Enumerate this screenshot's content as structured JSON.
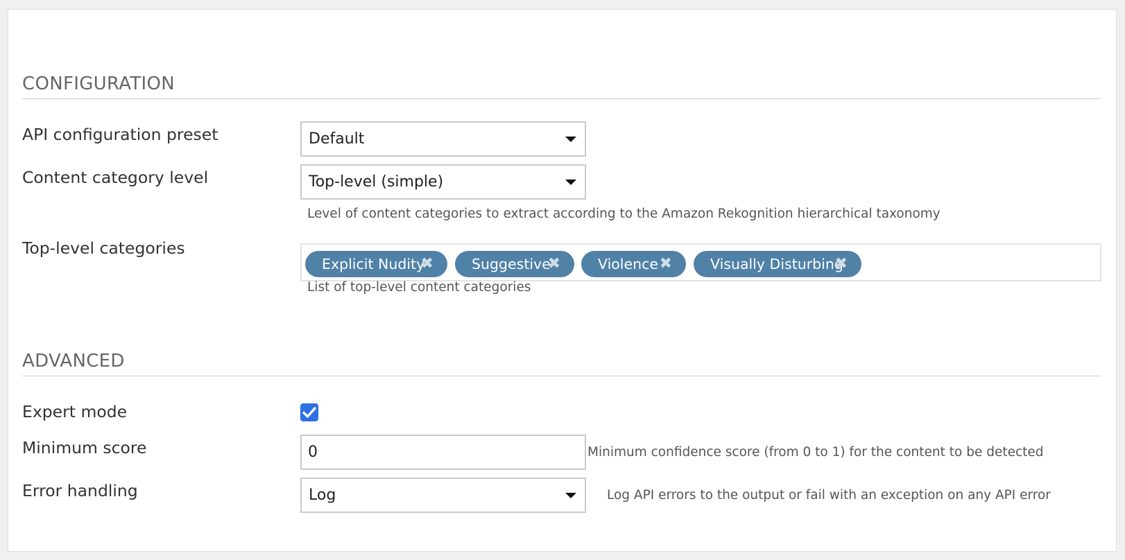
{
  "sections": {
    "configuration": "CONFIGURATION",
    "advanced": "ADVANCED"
  },
  "fields": {
    "api_preset": {
      "label": "API configuration preset",
      "value": "Default"
    },
    "category_level": {
      "label": "Content category level",
      "value": "Top-level (simple)",
      "help": "Level of content categories to extract according to the Amazon Rekognition hierarchical taxonomy"
    },
    "top_level_categories": {
      "label": "Top-level categories",
      "tags": [
        "Explicit Nudity",
        "Suggestive",
        "Violence",
        "Visually Disturbing"
      ],
      "remove_glyph": "✖",
      "help": "List of top-level content categories"
    },
    "expert_mode": {
      "label": "Expert mode",
      "checked": true
    },
    "minimum_score": {
      "label": "Minimum score",
      "value": "0",
      "help": "Minimum confidence score (from 0 to 1) for the content to be detected"
    },
    "error_handling": {
      "label": "Error handling",
      "value": "Log",
      "help": "Log API errors to the output or fail with an exception on any API error"
    }
  },
  "colors": {
    "tag_background": "#5081a7",
    "checkbox_accent": "#2e6fe3"
  }
}
